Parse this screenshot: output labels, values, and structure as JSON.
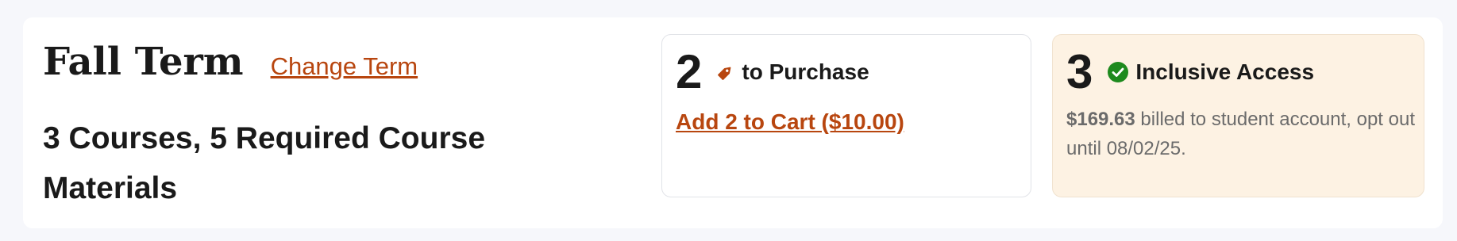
{
  "term": {
    "title": "Fall Term",
    "change_label": "Change Term"
  },
  "summary": {
    "line1": "3 Courses, 5 Required Course",
    "line2": "Materials"
  },
  "purchase_card": {
    "count": "2",
    "icon": "price-tag-icon",
    "label": "to Purchase",
    "action": "Add 2 to Cart ($10.00)"
  },
  "inclusive_card": {
    "count": "3",
    "icon": "check-circle-icon",
    "label": "Inclusive Access",
    "amount": "$169.63",
    "billing_text": " billed to student account, opt out until 08/02/25."
  },
  "colors": {
    "accent": "#b8460f",
    "success": "#1e8a1e",
    "inclusive_bg": "#fdf2e3",
    "page_bg": "#f6f7fb"
  }
}
